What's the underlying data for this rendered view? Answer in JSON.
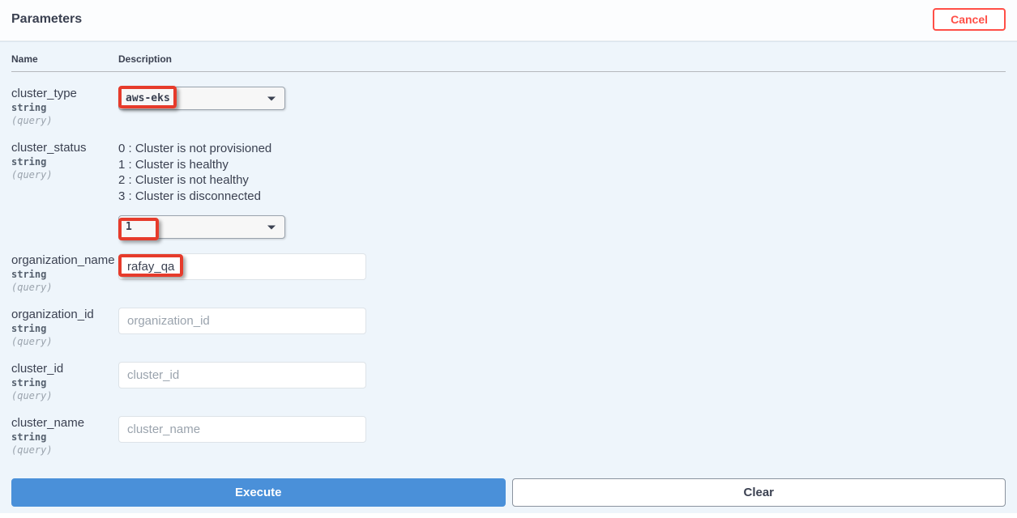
{
  "header": {
    "title": "Parameters",
    "cancel_label": "Cancel"
  },
  "columns": {
    "name": "Name",
    "description": "Description"
  },
  "params": {
    "cluster_type": {
      "name": "cluster_type",
      "type": "string",
      "in": "(query)",
      "selected": "aws-eks"
    },
    "cluster_status": {
      "name": "cluster_status",
      "type": "string",
      "in": "(query)",
      "desc_lines": {
        "l0": "0 : Cluster is not provisioned",
        "l1": "1 : Cluster is healthy",
        "l2": "2 : Cluster is not healthy",
        "l3": "3 : Cluster is disconnected"
      },
      "selected": "1"
    },
    "organization_name": {
      "name": "organization_name",
      "type": "string",
      "in": "(query)",
      "value": "rafay_qa",
      "placeholder": "organization_name"
    },
    "organization_id": {
      "name": "organization_id",
      "type": "string",
      "in": "(query)",
      "value": "",
      "placeholder": "organization_id"
    },
    "cluster_id": {
      "name": "cluster_id",
      "type": "string",
      "in": "(query)",
      "value": "",
      "placeholder": "cluster_id"
    },
    "cluster_name": {
      "name": "cluster_name",
      "type": "string",
      "in": "(query)",
      "value": "",
      "placeholder": "cluster_name"
    }
  },
  "actions": {
    "execute": "Execute",
    "clear": "Clear"
  },
  "highlights": {
    "h1": "aws-eks",
    "h2": "1",
    "h3": "rafay_qa"
  }
}
